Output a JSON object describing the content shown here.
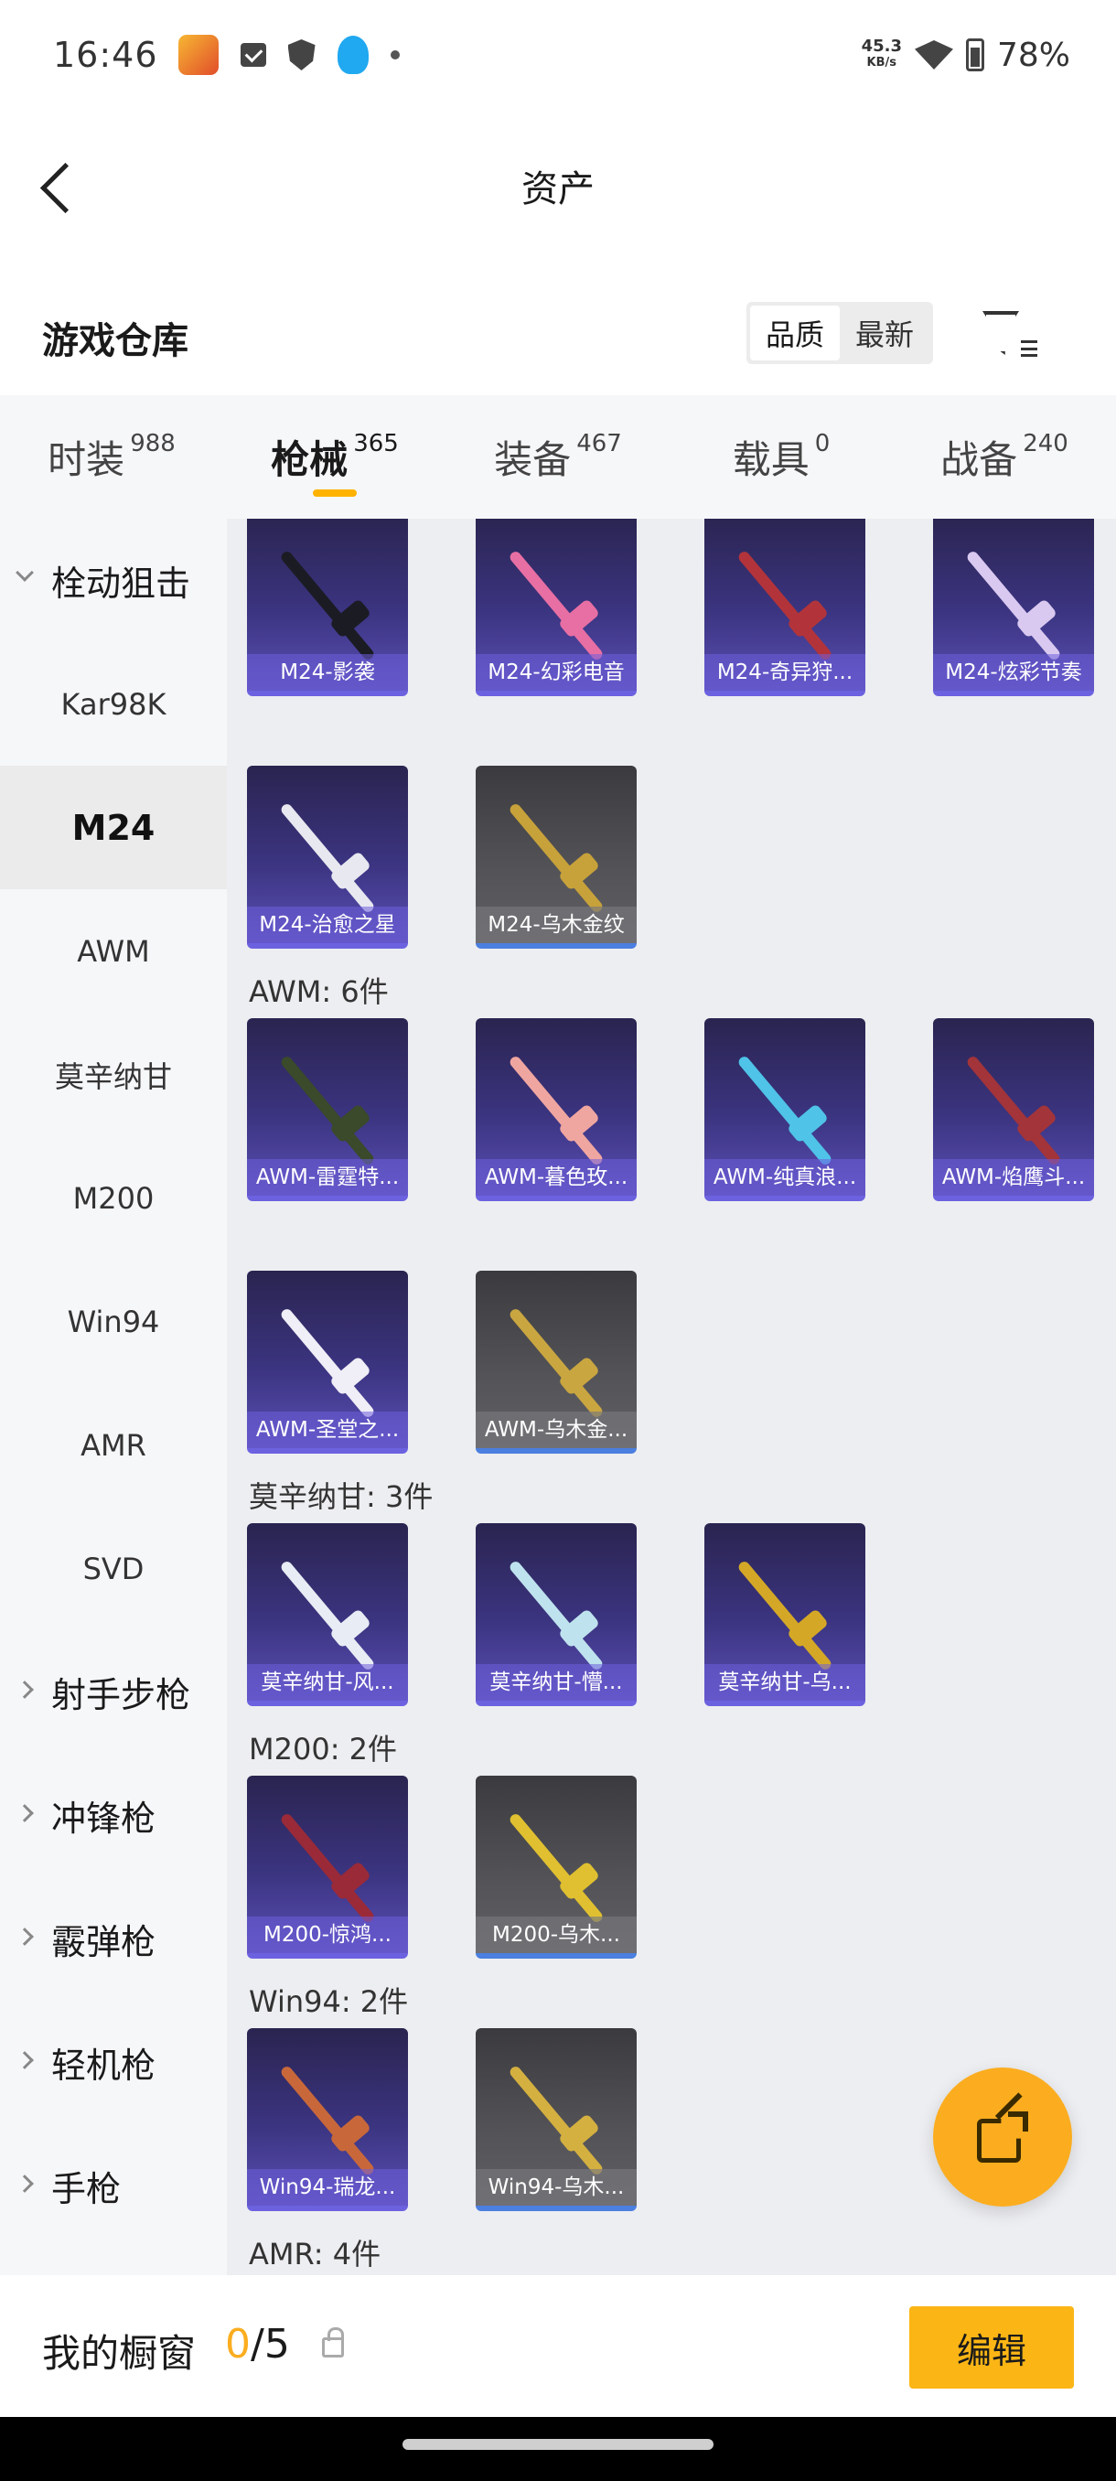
{
  "status_bar": {
    "time": "16:46",
    "speed_value": "45.3",
    "speed_unit": "KB/s",
    "battery": "78%"
  },
  "header": {
    "title": "资产"
  },
  "warehouse": {
    "title": "游戏仓库",
    "sort_quality": "品质",
    "sort_latest": "最新"
  },
  "tabs": [
    {
      "label": "时装",
      "count": "988"
    },
    {
      "label": "枪械",
      "count": "365"
    },
    {
      "label": "装备",
      "count": "467"
    },
    {
      "label": "载具",
      "count": "0"
    },
    {
      "label": "战备",
      "count": "240"
    }
  ],
  "sidebar": {
    "items": [
      {
        "label": "栓动狙击",
        "type": "group"
      },
      {
        "label": "Kar98K",
        "type": "sub"
      },
      {
        "label": "M24",
        "type": "sub"
      },
      {
        "label": "AWM",
        "type": "sub"
      },
      {
        "label": "莫辛纳甘",
        "type": "sub"
      },
      {
        "label": "M200",
        "type": "sub"
      },
      {
        "label": "Win94",
        "type": "sub"
      },
      {
        "label": "AMR",
        "type": "sub"
      },
      {
        "label": "SVD",
        "type": "sub"
      },
      {
        "label": "射手步枪",
        "type": "group"
      },
      {
        "label": "冲锋枪",
        "type": "group"
      },
      {
        "label": "霰弹枪",
        "type": "group"
      },
      {
        "label": "轻机枪",
        "type": "group"
      },
      {
        "label": "手枪",
        "type": "group"
      }
    ]
  },
  "sections": [
    {
      "title": "",
      "items": [
        {
          "name": "M24-影袭",
          "style": "purple"
        },
        {
          "name": "M24-幻彩电音",
          "style": "purple"
        },
        {
          "name": "M24-奇异狩...",
          "style": "purple"
        },
        {
          "name": "M24-炫彩节奏",
          "style": "purple"
        },
        {
          "name": "M24-治愈之星",
          "style": "purple"
        },
        {
          "name": "M24-乌木金纹",
          "style": "grey"
        }
      ]
    },
    {
      "title": "AWM: 6件",
      "items": [
        {
          "name": "AWM-雷霆特...",
          "style": "purple"
        },
        {
          "name": "AWM-暮色玫...",
          "style": "purple"
        },
        {
          "name": "AWM-纯真浪...",
          "style": "purple"
        },
        {
          "name": "AWM-焰鹰斗...",
          "style": "purple"
        },
        {
          "name": "AWM-圣堂之...",
          "style": "purple"
        },
        {
          "name": "AWM-乌木金...",
          "style": "grey"
        }
      ]
    },
    {
      "title": "莫辛纳甘: 3件",
      "items": [
        {
          "name": "莫辛纳甘-风...",
          "style": "purple"
        },
        {
          "name": "莫辛纳甘-懵...",
          "style": "purple"
        },
        {
          "name": "莫辛纳甘-乌...",
          "style": "purple"
        }
      ]
    },
    {
      "title": "M200: 2件",
      "items": [
        {
          "name": "M200-惊鸿...",
          "style": "purple"
        },
        {
          "name": "M200-乌木...",
          "style": "grey"
        }
      ]
    },
    {
      "title": "Win94: 2件",
      "items": [
        {
          "name": "Win94-瑞龙...",
          "style": "purple"
        },
        {
          "name": "Win94-乌木...",
          "style": "grey"
        }
      ]
    },
    {
      "title": "AMR: 4件",
      "items": []
    }
  ],
  "gun_colors": [
    "#1b1b24",
    "#e86fa3",
    "#b2343a",
    "#d9c9f0",
    "#e8e8f0",
    "#c7a13a",
    "#3a4a2a",
    "#f0a6a0",
    "#4fc3e8",
    "#a2343a",
    "#f0eef6",
    "#caa640",
    "#e8ecf4",
    "#bfe3ee",
    "#d4a826",
    "#9a2a38",
    "#e0c030",
    "#c8683a",
    "#d4b040"
  ],
  "bottom_bar": {
    "label": "我的橱窗",
    "current": "0",
    "total": "/5",
    "edit_label": "编辑"
  }
}
